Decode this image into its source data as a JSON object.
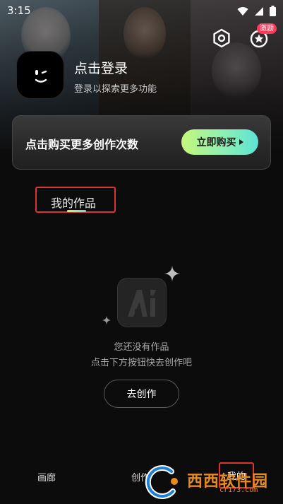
{
  "status_bar": {
    "time": "3:15"
  },
  "header": {
    "settings_icon": "hexagon-gear-icon",
    "reward_icon": "star-badge-icon",
    "reward_badge": "激励"
  },
  "profile": {
    "title": "点击登录",
    "subtitle": "登录以探索更多功能"
  },
  "banner": {
    "text": "点击购买更多创作次数",
    "button_label": "立即购买",
    "accent_gradient": [
      "#c6f77a",
      "#5de2d4"
    ]
  },
  "works_tab": {
    "label": "我的作品"
  },
  "empty_state": {
    "line1": "您还没有作品",
    "line2": "点击下方按钮快去创作吧",
    "button_label": "去创作"
  },
  "bottom_nav": {
    "items": [
      {
        "label": "画廊"
      },
      {
        "label": "创作"
      },
      {
        "label": "我的"
      }
    ]
  },
  "watermark": {
    "text": "西西软件园",
    "sub": "cr173.com"
  },
  "colors": {
    "highlight_box": "#e0332f",
    "background": "#0c0c0c"
  }
}
